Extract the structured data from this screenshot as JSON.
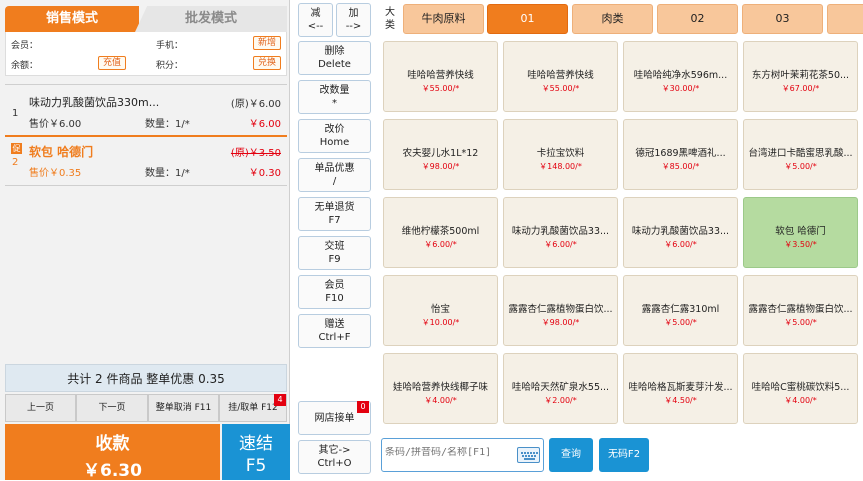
{
  "left": {
    "tab_sale": "销售模式",
    "tab_wholesale": "批发模式",
    "member_label": "会员：",
    "phone_label": "手机：",
    "add_label": "新增",
    "balance_label": "余额：",
    "recharge_label": "充值",
    "points_label": "积分：",
    "redeem_label": "兑换",
    "items": [
      {
        "no": "1",
        "name": "味动力乳酸菌饮品330m...",
        "orig_price": "(原)￥6.00",
        "price": "售价￥6.00",
        "qty": "数量：1/*",
        "subtotal": "￥6.00"
      },
      {
        "no": "2",
        "tag": "促",
        "name": "软包 哈德门",
        "orig_price": "(原)￥3.50",
        "price": "售价￥0.35",
        "qty": "数量：1/*",
        "subtotal": "￥0.30"
      }
    ],
    "summary": "共计 2 件商品 整单优惠 0.35",
    "nav": {
      "prev": "上一页",
      "next": "下一页",
      "cancel": "整单取消 F11",
      "hold": "挂/取单 F12",
      "hold_badge": "4"
    },
    "pay_label": "收款",
    "pay_amount": "￥6.30",
    "quick_label": "速结",
    "quick_key": "F5"
  },
  "functions": {
    "minus": [
      "减",
      "<--"
    ],
    "plus": [
      "加",
      "-->"
    ],
    "delete": [
      "删除",
      "Delete"
    ],
    "change_qty": [
      "改数量",
      "*"
    ],
    "change_price": [
      "改价",
      "Home"
    ],
    "item_discount": [
      "单品优惠",
      "/"
    ],
    "no_receipt_return": [
      "无单退货",
      "F7"
    ],
    "shift": [
      "交班",
      "F9"
    ],
    "member": [
      "会员",
      "F10"
    ],
    "gift": [
      "赠送",
      "Ctrl+F"
    ],
    "online_orders": "网店接单",
    "online_badge": "0",
    "other": [
      "其它->",
      "Ctrl+O"
    ]
  },
  "categories": {
    "big_label": [
      "大",
      "类"
    ],
    "items": [
      "牛肉原料",
      "01",
      "肉类",
      "02",
      "03"
    ],
    "active_index": 1
  },
  "products": [
    {
      "name": "哇哈哈营养快线",
      "price": "￥55.00/*"
    },
    {
      "name": "哇哈哈营养快线",
      "price": "￥55.00/*"
    },
    {
      "name": "哇哈哈纯净水596m...",
      "price": "￥30.00/*"
    },
    {
      "name": "东方树叶茉莉花茶50...",
      "price": "￥67.00/*"
    },
    {
      "name": "农夫婴儿水1L*12",
      "price": "￥98.00/*"
    },
    {
      "name": "卡拉宝饮料",
      "price": "￥148.00/*"
    },
    {
      "name": "德冠1689黑啤酒礼...",
      "price": "￥85.00/*"
    },
    {
      "name": "台湾进口卡酷蜜思乳酸...",
      "price": "￥5.00/*"
    },
    {
      "name": "维他柠檬茶500ml",
      "price": "￥6.00/*"
    },
    {
      "name": "味动力乳酸菌饮品33...",
      "price": "￥6.00/*"
    },
    {
      "name": "味动力乳酸菌饮品33...",
      "price": "￥6.00/*"
    },
    {
      "name": "软包 哈德门",
      "price": "￥3.50/*"
    },
    {
      "name": "怡宝",
      "price": "￥10.00/*"
    },
    {
      "name": "露露杏仁露植物蛋白饮...",
      "price": "￥98.00/*"
    },
    {
      "name": "露露杏仁露310ml",
      "price": "￥5.00/*"
    },
    {
      "name": "露露杏仁露植物蛋白饮...",
      "price": "￥5.00/*"
    },
    {
      "name": "娃哈哈营养快线椰子味",
      "price": "￥4.00/*"
    },
    {
      "name": "哇哈哈天然矿泉水55...",
      "price": "￥2.00/*"
    },
    {
      "name": "哇哈哈格瓦斯麦芽汁发...",
      "price": "￥4.50/*"
    },
    {
      "name": "哇哈哈C蜜桃碳饮料5...",
      "price": "￥4.00/*"
    }
  ],
  "selected_product_index": 11,
  "search": {
    "placeholder": "条码/拼音码/名称[F1]",
    "query_label": "查询",
    "no_code_label": "无码F2"
  },
  "colors": {
    "accent_orange": "#f07d1e",
    "accent_blue": "#1a93d4",
    "price_red": "#e3000f",
    "selected_green": "#b5dba0"
  }
}
